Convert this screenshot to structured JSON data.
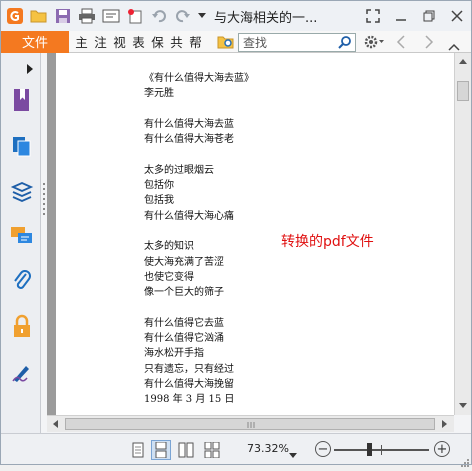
{
  "window": {
    "title": "与大海相关的一..."
  },
  "menu": {
    "file_label": "文件",
    "items": [
      "主",
      "注",
      "视",
      "表",
      "保",
      "共",
      "帮"
    ],
    "search_placeholder": "查找"
  },
  "document": {
    "poem_lines": [
      "《有什么值得大海去蓝》",
      "李元胜",
      "",
      "有什么值得大海去蓝",
      "有什么值得大海苍老",
      "",
      "太多的过眼烟云",
      "包括你",
      "包括我",
      "有什么值得大海心痛",
      "",
      "太多的知识",
      "使大海充满了苦涩",
      "也使它变得",
      "像一个巨大的筛子",
      "",
      "有什么值得它去蓝",
      "有什么值得它汹涌",
      "海水松开手指",
      "只有遗忘，只有经过",
      "有什么值得大海挽留",
      "1998 年 3 月 15 日"
    ],
    "annotation": "转换的pdf文件"
  },
  "statusbar": {
    "zoom": "73.32%"
  },
  "colors": {
    "accent": "#f47920",
    "annotation": "#e01010"
  }
}
